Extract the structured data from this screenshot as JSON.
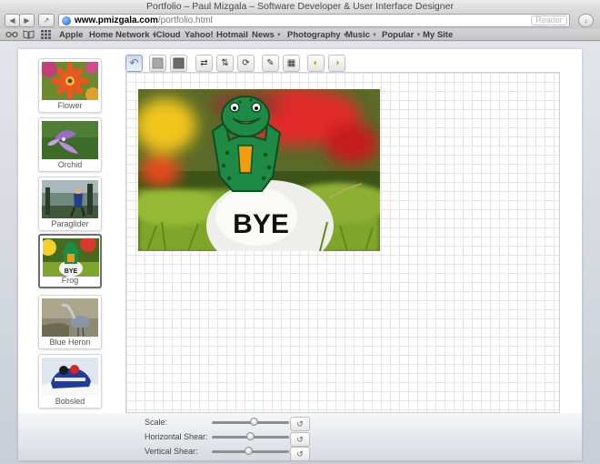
{
  "window": {
    "title": "Portfolio – Paul Mizgala – Software Developer & User Interface Designer"
  },
  "toolbar": {
    "back": "◀",
    "forward": "▶",
    "share": "↗",
    "url_host": "www.pmizgala.com",
    "url_path": "/portfolio.html",
    "reader": "Reader",
    "downloads": "↓"
  },
  "bookmarks": {
    "reading_list_icon": "glasses-icon",
    "items": [
      {
        "label": "Apple"
      },
      {
        "label": "Home Network",
        "menu": "▼"
      },
      {
        "label": "iCloud"
      },
      {
        "label": "Yahoo!"
      },
      {
        "label": "Hotmail"
      },
      {
        "label": "News",
        "menu": "▼"
      },
      {
        "label": "Photography",
        "menu": "▼"
      },
      {
        "label": "Music",
        "menu": "▼"
      },
      {
        "label": "Popular",
        "menu": "▼"
      },
      {
        "label": "My Site"
      }
    ]
  },
  "gallery": {
    "selected": "Frog",
    "items": [
      {
        "caption": "Flower"
      },
      {
        "caption": "Orchid"
      },
      {
        "caption": "Paraglider"
      },
      {
        "caption": "Frog"
      },
      {
        "caption": "Blue Heron"
      },
      {
        "caption": "Bobsled"
      }
    ]
  },
  "tools": [
    {
      "icon": "undo-icon",
      "glyph": "↶"
    },
    {
      "icon": "opacity-light-icon",
      "glyph": ""
    },
    {
      "icon": "opacity-dark-icon",
      "glyph": ""
    },
    {
      "icon": "flip-horizontal-icon",
      "glyph": "⇄"
    },
    {
      "icon": "flip-vertical-icon",
      "glyph": "⇅"
    },
    {
      "icon": "rotate-icon",
      "glyph": "⟳"
    },
    {
      "icon": "sketch-icon",
      "glyph": "✎"
    },
    {
      "icon": "emboss-icon",
      "glyph": "▦"
    },
    {
      "icon": "light-left-icon",
      "glyph": "◐"
    },
    {
      "icon": "light-right-icon",
      "glyph": "◑"
    }
  ],
  "photo": {
    "sign_text": "BYE"
  },
  "controls": {
    "scale_label": "Scale:",
    "scale_value": 0.55,
    "hshear_label": "Horizontal Shear:",
    "hshear_value": 0.5,
    "vshear_label": "Vertical Shear:",
    "vshear_value": 0.47,
    "reset": "↺"
  },
  "colors": {
    "accent": "#4a78b8",
    "frog_green": "#1f8a45",
    "frog_orange": "#f39c12"
  }
}
